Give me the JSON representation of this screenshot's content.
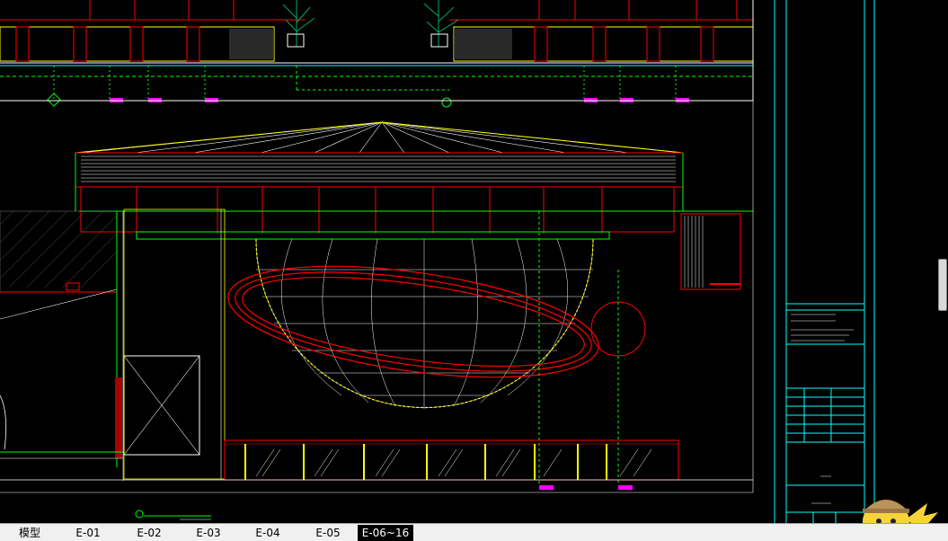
{
  "tabs": [
    {
      "label": "模型",
      "active": false
    },
    {
      "label": "E-01",
      "active": false
    },
    {
      "label": "E-02",
      "active": false
    },
    {
      "label": "E-03",
      "active": false
    },
    {
      "label": "E-04",
      "active": false
    },
    {
      "label": "E-05",
      "active": false
    },
    {
      "label": "E-06~16",
      "active": true
    }
  ],
  "colors": {
    "background": "#000000",
    "red": "#ff0000",
    "green": "#00ff00",
    "yellow": "#ffff00",
    "cyan": "#00ffff",
    "white": "#ffffff",
    "gray": "#808080",
    "magenta": "#ff00ff"
  },
  "icons": {
    "mascot": "pikachu-detective-icon",
    "scroll": "vertical-scrollbar-handle"
  }
}
